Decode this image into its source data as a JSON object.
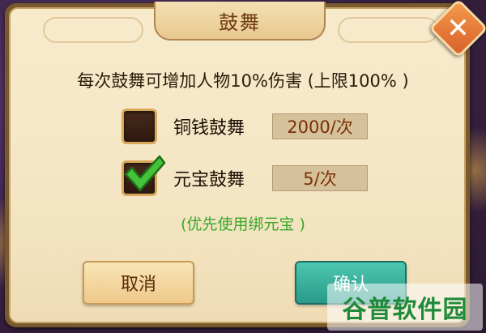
{
  "dialog": {
    "title": "鼓舞",
    "description": "每次鼓舞可增加人物10%伤害 (上限100% )",
    "options": [
      {
        "label": "铜钱鼓舞",
        "price": "2000/次",
        "checked": false
      },
      {
        "label": "元宝鼓舞",
        "price": "5/次",
        "checked": true
      }
    ],
    "note": "(优先使用绑元宝 )",
    "cancel_label": "取消",
    "confirm_label": "确认",
    "close_icon": "close-icon"
  },
  "watermark": {
    "text": "谷普软件园"
  },
  "colors": {
    "title_text": "#6e3a12",
    "price_text": "#7a2e08",
    "note_text": "#3aa82a",
    "confirm_bg": "#2a9a8a",
    "close_bg": "#d9602a"
  }
}
